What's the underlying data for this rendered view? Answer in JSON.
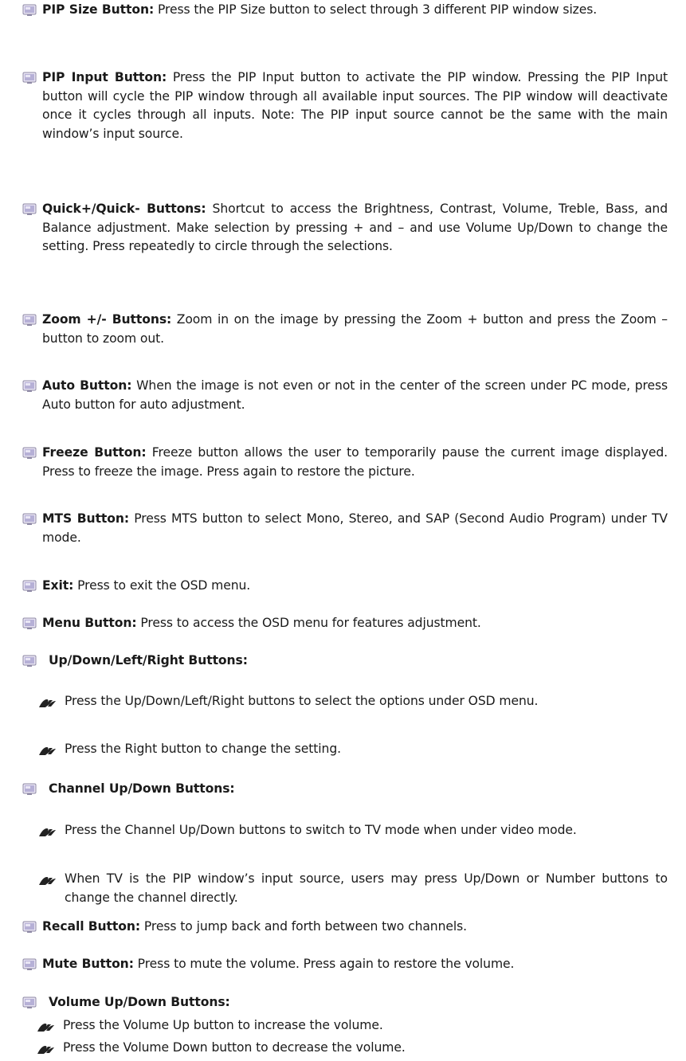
{
  "items": [
    {
      "term": "PIP Size Button:",
      "desc": " Press the PIP Size button to select through 3 different PIP window sizes."
    },
    {
      "term": "PIP Input Button:",
      "desc": " Press the PIP Input button to activate the PIP window. Pressing the PIP Input button will cycle the PIP window through all available input sources. The PIP window will deactivate once it cycles through all inputs. Note: The PIP input source cannot be the same with the main window’s input source."
    },
    {
      "term": "Quick+/Quick- Buttons:",
      "desc": " Shortcut to access the Brightness, Contrast, Volume, Treble, Bass, and Balance adjustment. Make selection by pressing + and – and use Volume Up/Down to change the setting. Press repeatedly to circle through the selections."
    },
    {
      "term": "Zoom +/- Buttons:",
      "desc": " Zoom in on the image by pressing the Zoom + button and press the Zoom – button to zoom out."
    },
    {
      "term": "Auto Button:",
      "desc": " When the image is not even or not in the center of the screen under PC mode, press Auto button for auto adjustment."
    },
    {
      "term": "Freeze Button:",
      "desc": " Freeze button allows the user to temporarily pause the current image displayed. Press to freeze the image. Press again to restore the picture."
    },
    {
      "term": "MTS Button:",
      "desc": " Press MTS button to select Mono, Stereo, and SAP (Second Audio Program) under TV mode."
    },
    {
      "term": "Exit:",
      "desc": " Press to exit the OSD menu."
    },
    {
      "term": "Menu Button:",
      "desc": " Press to access the OSD menu for features adjustment."
    },
    {
      "term": "Up/Down/Left/Right Buttons:",
      "desc": ""
    },
    {
      "term": "Channel Up/Down Buttons:",
      "desc": ""
    },
    {
      "term": "Recall Button:",
      "desc": " Press to jump back and forth between two channels."
    },
    {
      "term": "Mute Button:",
      "desc": " Press to mute the volume. Press again to restore the volume."
    },
    {
      "term": "Volume Up/Down Buttons:",
      "desc": ""
    }
  ],
  "subs": [
    {
      "text": "Press the Up/Down/Left/Right buttons to select the options under OSD menu."
    },
    {
      "text": "Press the Right button to change the setting."
    },
    {
      "text": "Press the Channel Up/Down buttons to switch to TV mode when under video mode."
    },
    {
      "text": "When TV is the PIP window’s input source, users may press Up/Down or Number buttons to change the channel directly."
    },
    {
      "text": "Press the Volume Up button to increase the volume."
    },
    {
      "text": "Press the Volume Down button to decrease the volume."
    }
  ],
  "icons": {
    "bullet": "monitor-bullet-icon",
    "sub_bullet": "hand-arrow-icon"
  }
}
